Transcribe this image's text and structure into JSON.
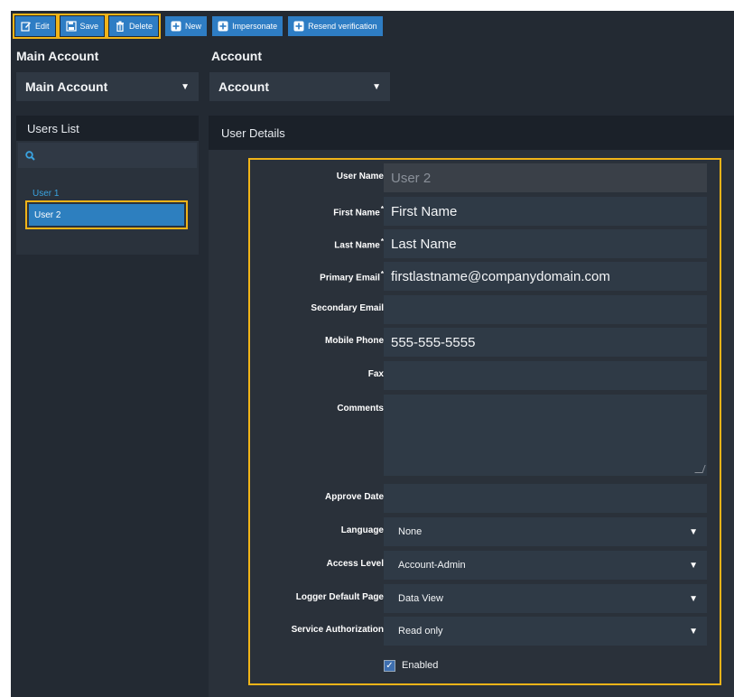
{
  "toolbar": {
    "edit": "Edit",
    "save": "Save",
    "delete": "Delete",
    "new": "New",
    "impersonate": "Impersonate",
    "resend": "Resend verification"
  },
  "filters": {
    "main_account_label": "Main Account",
    "main_account_value": "Main Account",
    "account_label": "Account",
    "account_value": "Account"
  },
  "users_list": {
    "title": "Users List",
    "items": [
      "User 1",
      "User 2"
    ],
    "selected": "User 2"
  },
  "user_details": {
    "title": "User Details",
    "fields": {
      "user_name": {
        "label": "User Name",
        "value": "User 2"
      },
      "first_name": {
        "label": "First Name",
        "value": "First Name"
      },
      "last_name": {
        "label": "Last Name",
        "value": "Last Name"
      },
      "primary_email": {
        "label": "Primary Email",
        "value": "firstlastname@companydomain.com"
      },
      "secondary_email": {
        "label": "Secondary Email",
        "value": ""
      },
      "mobile_phone": {
        "label": "Mobile Phone",
        "value": "555-555-5555"
      },
      "fax": {
        "label": "Fax",
        "value": ""
      },
      "comments": {
        "label": "Comments",
        "value": ""
      },
      "approve_date": {
        "label": "Approve Date",
        "value": ""
      },
      "language": {
        "label": "Language",
        "value": "None"
      },
      "access_level": {
        "label": "Access Level",
        "value": "Account-Admin"
      },
      "logger_default_page": {
        "label": "Logger Default Page",
        "value": "Data View"
      },
      "service_authorization": {
        "label": "Service Authorization",
        "value": "Read only"
      }
    },
    "enabled_label": "Enabled",
    "enabled": true,
    "required_marker": "*"
  },
  "colors": {
    "accent": "#2e7dc4",
    "highlight": "#f0b418",
    "background": "#232a33"
  }
}
